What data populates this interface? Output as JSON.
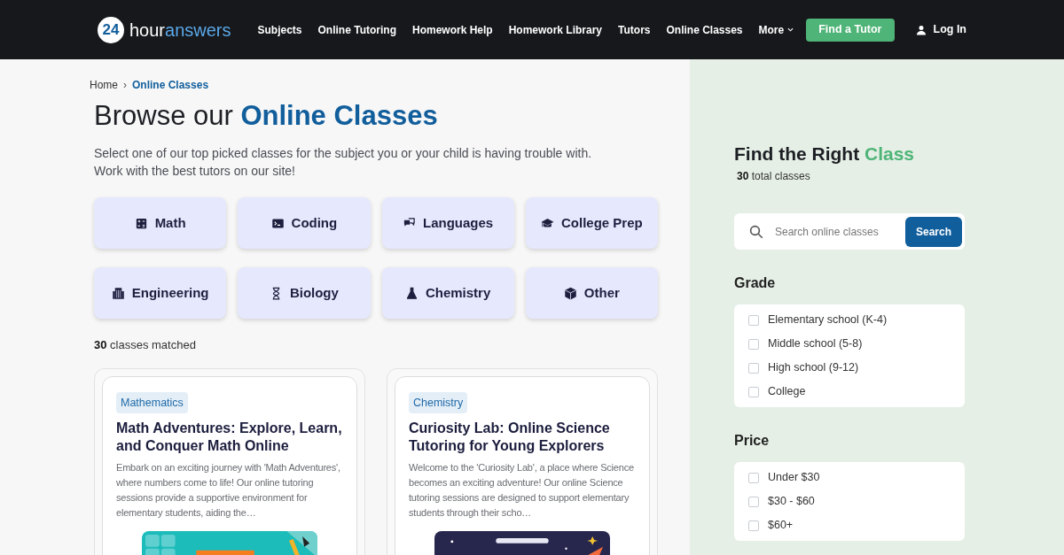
{
  "header": {
    "logo": {
      "badge": "24",
      "word": "hour",
      "accent": "answers"
    },
    "nav": [
      {
        "label": "Subjects",
        "dropdown": false
      },
      {
        "label": "Online Tutoring",
        "dropdown": false
      },
      {
        "label": "Homework Help",
        "dropdown": false
      },
      {
        "label": "Homework Library",
        "dropdown": false
      },
      {
        "label": "Tutors",
        "dropdown": false
      },
      {
        "label": "Online Classes",
        "dropdown": false
      },
      {
        "label": "More",
        "dropdown": true
      }
    ],
    "cta": "Find a Tutor",
    "login": "Log In"
  },
  "breadcrumb": {
    "separator": "›",
    "items": [
      {
        "label": "Home",
        "current": false
      },
      {
        "label": "Online Classes",
        "current": true
      }
    ]
  },
  "title": {
    "lead": "Browse our",
    "accent": "Online Classes"
  },
  "intro": [
    "Select one of our top picked classes for the subject you or your child is having trouble with.",
    "Work with the best tutors on our site!"
  ],
  "categories": [
    {
      "label": "Math"
    },
    {
      "label": "Coding"
    },
    {
      "label": "Languages"
    },
    {
      "label": "College Prep"
    },
    {
      "label": "Engineering"
    },
    {
      "label": "Biology"
    },
    {
      "label": "Chemistry"
    },
    {
      "label": "Other"
    }
  ],
  "matched": {
    "count": "30",
    "label": "classes matched"
  },
  "classes": [
    {
      "tag": "Mathematics",
      "title": "Math Adventures: Explore, Learn, and Conquer Math Online",
      "description": "Embark on an exciting journey with 'Math Adventures', where numbers come to life! Our online tutoring sessions provide a supportive environment for elementary students, aiding the…"
    },
    {
      "tag": "Chemistry",
      "title": "Curiosity Lab: Online Science Tutoring for Young Explorers",
      "description": "Welcome to the 'Curiosity Lab', a place where Science becomes an exciting adventure! Our online Science tutoring sessions are designed to support elementary students through their scho…"
    }
  ],
  "sidebar": {
    "heading": {
      "lead": "Find the Right",
      "accent": "Class"
    },
    "total": {
      "count": "30",
      "label": "total classes"
    },
    "search": {
      "placeholder": "Search online classes",
      "button": "Search"
    },
    "filters": [
      {
        "title": "Grade",
        "options": [
          {
            "label": "Elementary school (K-4)",
            "checked": false
          },
          {
            "label": "Middle school (5-8)",
            "checked": false
          },
          {
            "label": "High school (9-12)",
            "checked": false
          },
          {
            "label": "College",
            "checked": false
          }
        ]
      },
      {
        "title": "Price",
        "options": [
          {
            "label": "Under $30",
            "checked": false
          },
          {
            "label": "$30 - $60",
            "checked": false
          },
          {
            "label": "$60+",
            "checked": false
          }
        ]
      }
    ]
  }
}
